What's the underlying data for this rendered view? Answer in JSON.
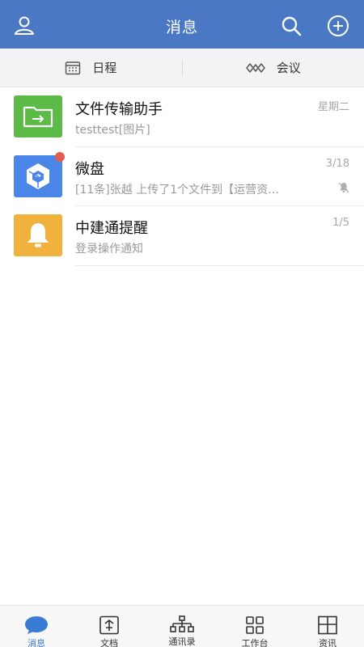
{
  "header": {
    "title": "消息",
    "icons": [
      "user-icon",
      "search-icon",
      "add-circle-icon"
    ]
  },
  "subbar": {
    "schedule_label": "日程",
    "meeting_label": "会议"
  },
  "conversations": [
    {
      "name": "文件传输助手",
      "preview": "testtest[图片]",
      "time": "星期二",
      "icon": "folder-transfer-icon",
      "color": "#5cba47"
    },
    {
      "name": "微盘",
      "preview": "[11条]张越 上传了1个文件到【运营资…",
      "time": "3/18",
      "icon": "micro-disk-icon",
      "color": "#4a86e8",
      "unread_dot": true,
      "muted": true
    },
    {
      "name": "中建通提醒",
      "preview": "登录操作通知",
      "time": "1/5",
      "icon": "bell-icon",
      "color": "#f0b23c"
    }
  ],
  "tabbar": {
    "items": [
      {
        "label": "消息",
        "icon": "chat-bubble-icon",
        "active": true
      },
      {
        "label": "文档",
        "icon": "document-icon",
        "active": false
      },
      {
        "label": "通讯录",
        "icon": "org-chart-icon",
        "active": false
      },
      {
        "label": "工作台",
        "icon": "grid-icon",
        "active": false
      },
      {
        "label": "资讯",
        "icon": "news-icon",
        "active": false
      }
    ]
  },
  "colors": {
    "header_bg": "#4a78c4",
    "active_tab": "#3a7bd5",
    "unread_dot": "#e45b4f"
  }
}
